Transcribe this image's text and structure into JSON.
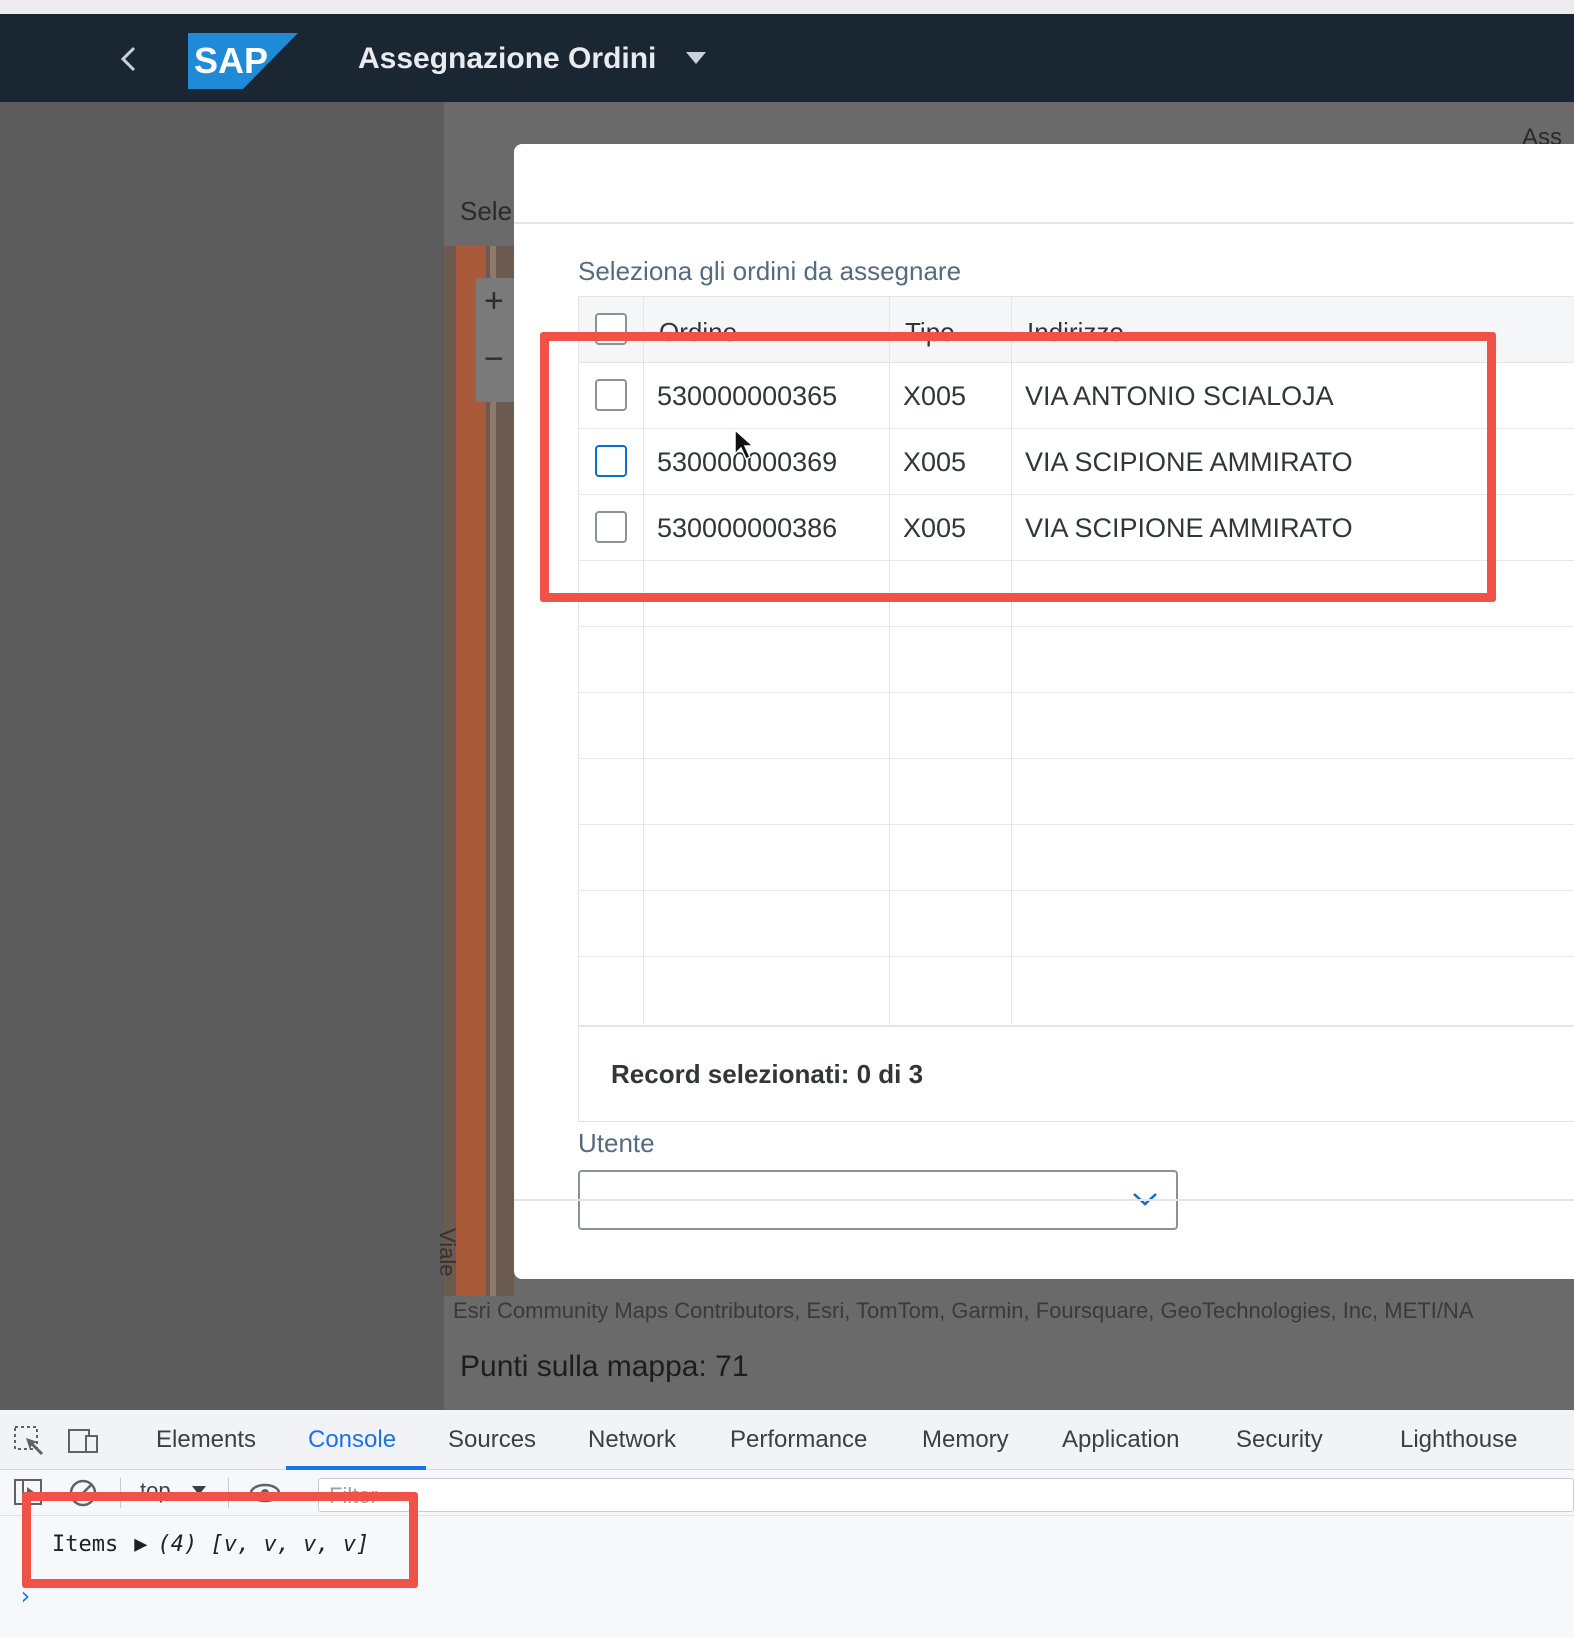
{
  "shell": {
    "title": "Assegnazione Ordini",
    "logo_text": "SAP",
    "icons": {
      "back": "chevron-left-icon",
      "caret": "caret-down-icon"
    },
    "colors": {
      "bar": "#1b2633",
      "logo_blue": "#1f8bd6"
    }
  },
  "background": {
    "section_label": "Sele",
    "right_label": "Ass",
    "zoom_in": "+",
    "zoom_out": "−",
    "street_label": "Viale",
    "map_credit": "Esri Community Maps Contributors, Esri, TomTom, Garmin, Foursquare, GeoTechnologies, Inc, METI/NA",
    "points_label": "Punti sulla mappa: 71"
  },
  "dialog": {
    "label": "Seleziona gli ordini da assegnare",
    "columns": [
      "Ordine",
      "Tipo",
      "Indirizzo"
    ],
    "rows": [
      {
        "ordine": "530000000365",
        "tipo": "X005",
        "indirizzo": "VIA ANTONIO SCIALOJA",
        "checked": false
      },
      {
        "ordine": "530000000369",
        "tipo": "X005",
        "indirizzo": "VIA SCIPIONE AMMIRATO",
        "checked": false
      },
      {
        "ordine": "530000000386",
        "tipo": "X005",
        "indirizzo": "VIA SCIPIONE AMMIRATO",
        "checked": false
      }
    ],
    "footer": "Record selezionati: 0 di 3",
    "user_label": "Utente",
    "user_value": ""
  },
  "devtools": {
    "tabs": [
      "Elements",
      "Console",
      "Sources",
      "Network",
      "Performance",
      "Memory",
      "Application",
      "Security",
      "Lighthouse"
    ],
    "active_tab": "Console",
    "context": "top",
    "filter_placeholder": "Filter",
    "console": {
      "label": "Items",
      "expander": "▶",
      "value": "(4) [v, v, v, v]"
    },
    "prompt": "›",
    "colors": {
      "active": "#1a73e8",
      "highlight": "#f05248"
    }
  }
}
